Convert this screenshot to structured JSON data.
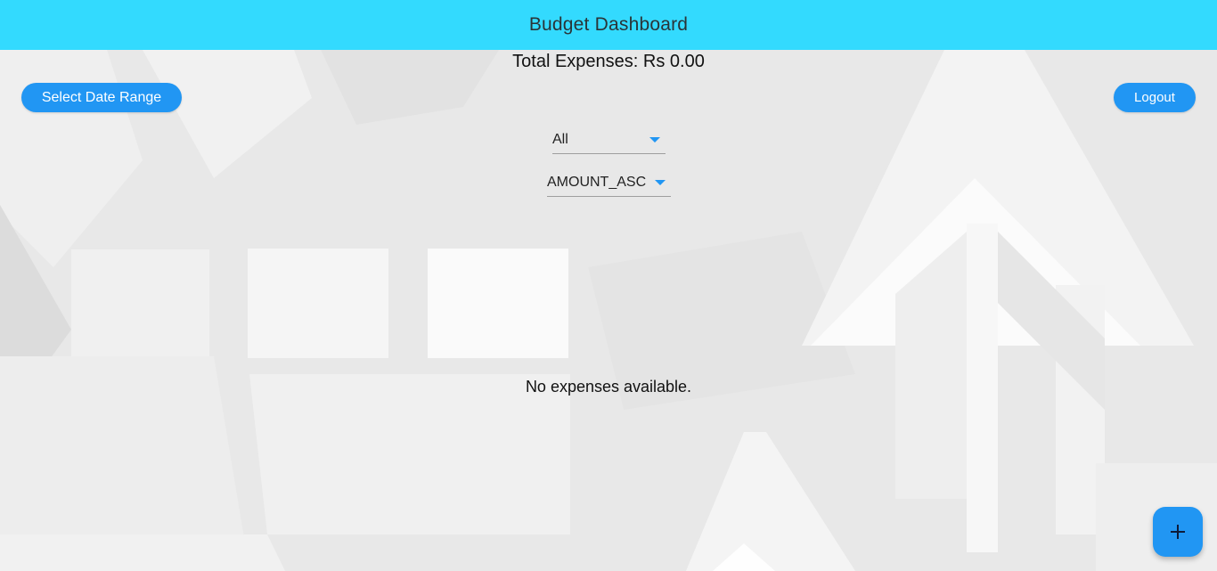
{
  "appbar": {
    "title": "Budget Dashboard"
  },
  "summary": {
    "total_label": "Total Expenses: Rs 0.00"
  },
  "actions": {
    "date_range_label": "Select Date Range",
    "logout_label": "Logout",
    "add_icon": "plus-icon"
  },
  "filters": {
    "category_selected": "All",
    "sort_selected": "AMOUNT_ASC"
  },
  "expenses": {
    "empty_message": "No expenses available."
  },
  "colors": {
    "appbar": "#33dafe",
    "accent": "#2196f3",
    "background": "#eaeaea"
  }
}
